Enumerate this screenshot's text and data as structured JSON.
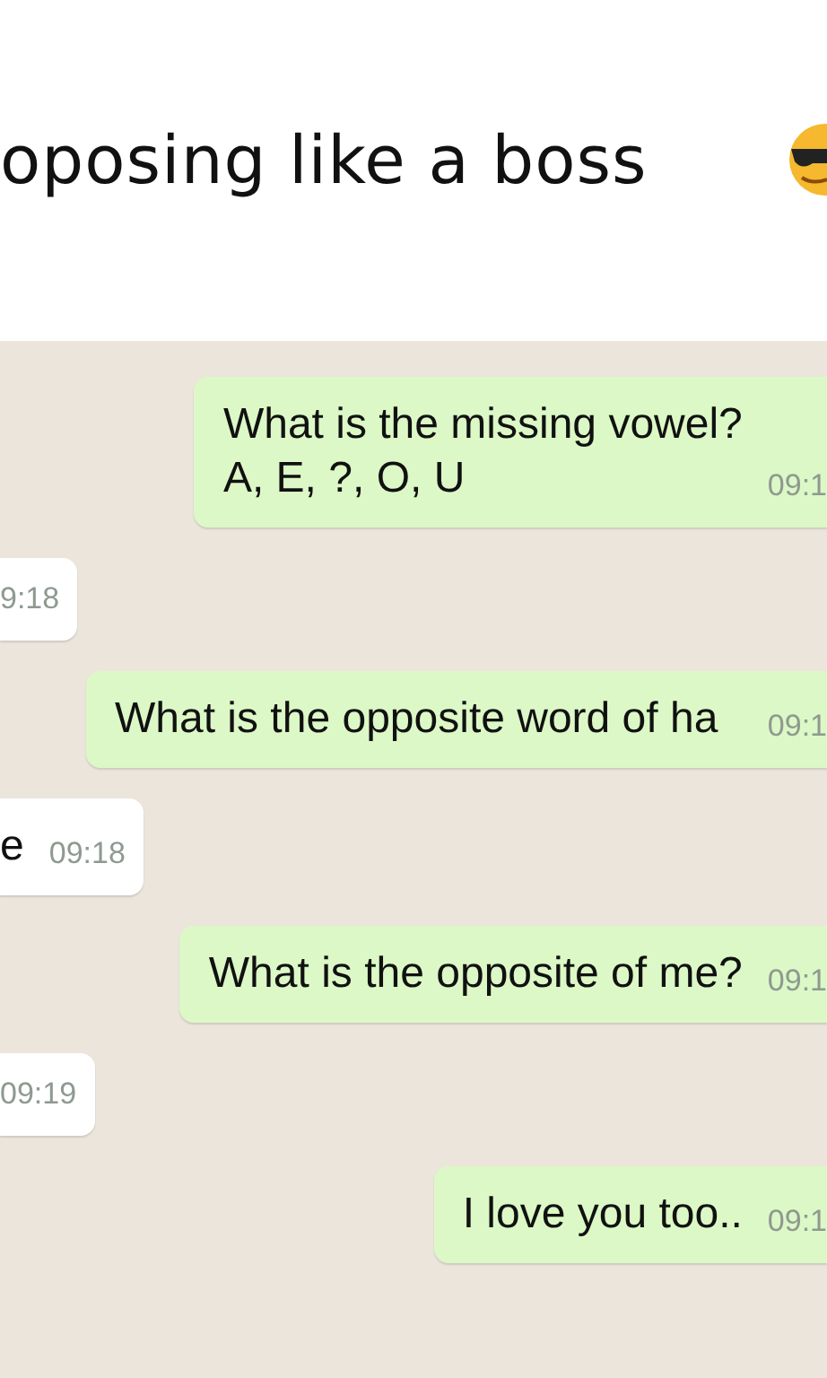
{
  "header": {
    "title": "oposing like a boss"
  },
  "messages": [
    {
      "kind": "outgoing",
      "text": "What is the missing vowel?\nA, E, ?, O, U",
      "time": "09:1"
    },
    {
      "kind": "incoming",
      "time": "9:18"
    },
    {
      "kind": "outgoing",
      "text": "What is the opposite word of ha",
      "time": "09:1"
    },
    {
      "kind": "incoming",
      "text": "e",
      "time": "09:18"
    },
    {
      "kind": "outgoing",
      "text": "What is the opposite of me?",
      "time": "09:1"
    },
    {
      "kind": "incoming",
      "time": "09:19"
    },
    {
      "kind": "outgoing",
      "text": "I love you too..",
      "time": "09:1"
    }
  ]
}
